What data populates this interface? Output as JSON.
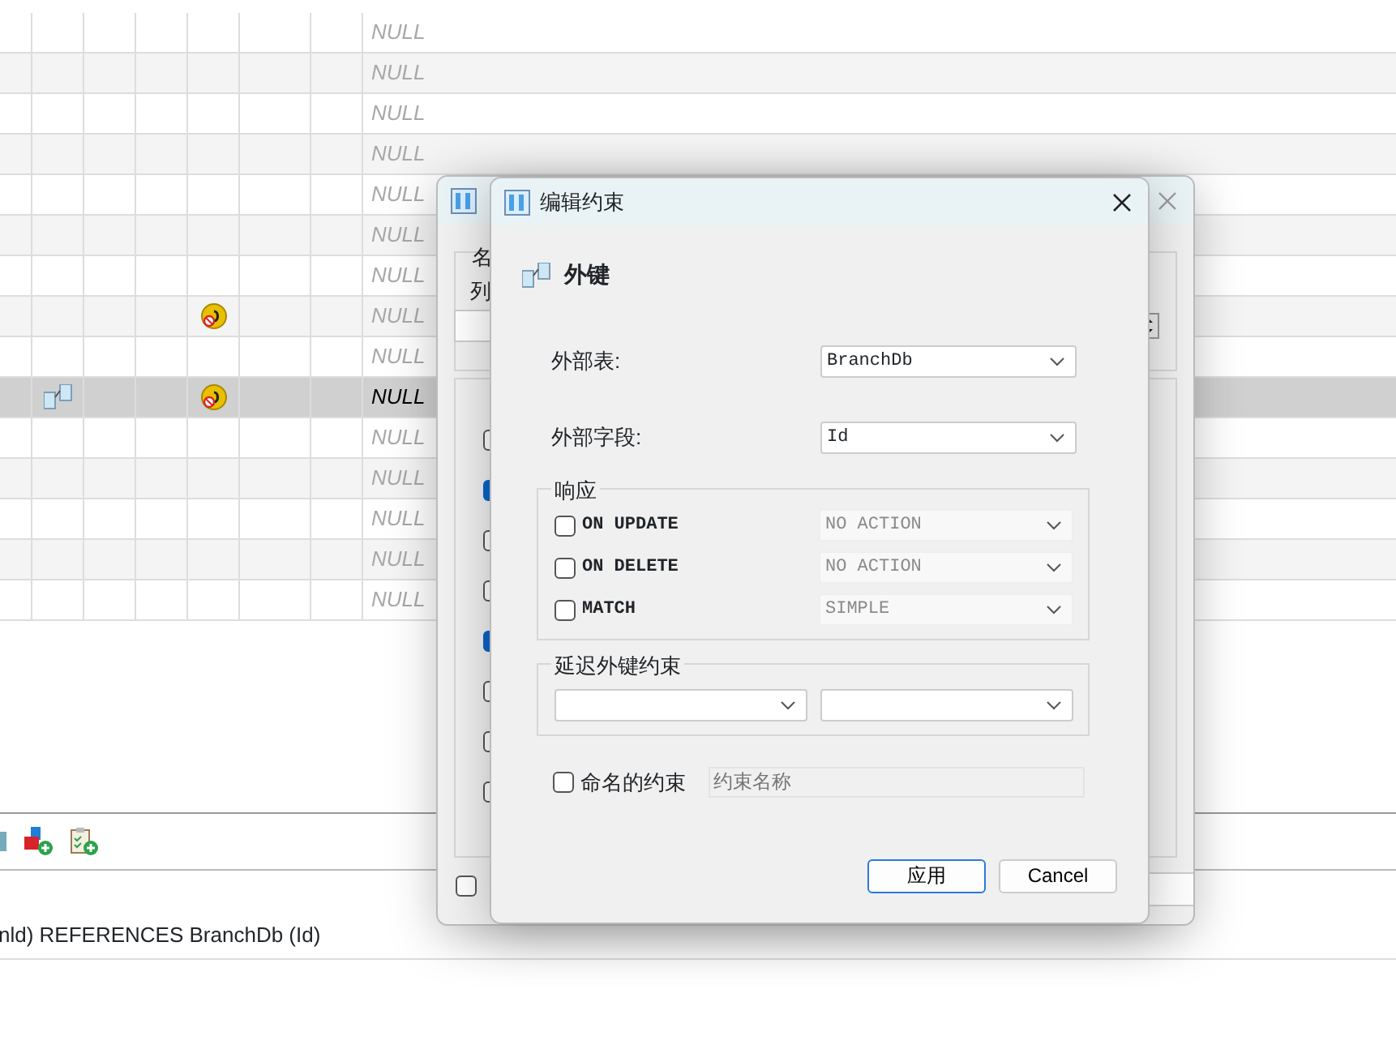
{
  "grid": {
    "rows": [
      {
        "selected": false,
        "foreign_key": false,
        "marked": false,
        "value": "NULL"
      },
      {
        "selected": false,
        "foreign_key": false,
        "marked": false,
        "value": "NULL"
      },
      {
        "selected": false,
        "foreign_key": false,
        "marked": false,
        "value": "NULL"
      },
      {
        "selected": false,
        "foreign_key": false,
        "marked": false,
        "value": "NULL"
      },
      {
        "selected": false,
        "foreign_key": false,
        "marked": false,
        "value": "NULL"
      },
      {
        "selected": false,
        "foreign_key": false,
        "marked": false,
        "value": "NULL"
      },
      {
        "selected": false,
        "foreign_key": false,
        "marked": false,
        "value": "NULL"
      },
      {
        "selected": false,
        "foreign_key": false,
        "marked": true,
        "value": "NULL"
      },
      {
        "selected": false,
        "foreign_key": false,
        "marked": false,
        "value": "NULL"
      },
      {
        "selected": true,
        "foreign_key": true,
        "marked": true,
        "value": "NULL"
      },
      {
        "selected": false,
        "foreign_key": false,
        "marked": false,
        "value": "NULL"
      },
      {
        "selected": false,
        "foreign_key": false,
        "marked": false,
        "value": "NULL"
      },
      {
        "selected": false,
        "foreign_key": false,
        "marked": false,
        "value": "NULL"
      },
      {
        "selected": false,
        "foreign_key": false,
        "marked": false,
        "value": "NULL"
      },
      {
        "selected": false,
        "foreign_key": false,
        "marked": false,
        "value": "NULL"
      }
    ]
  },
  "sql_preview": "nld) REFERENCES BranchDb (Id)",
  "back_dialog": {
    "name_label": "名",
    "column_label": "列",
    "checkboxes": [
      {
        "checked": false
      },
      {
        "checked": true
      },
      {
        "checked": false
      },
      {
        "checked": false
      },
      {
        "checked": true
      },
      {
        "checked": false
      },
      {
        "checked": false
      },
      {
        "checked": false
      }
    ],
    "advanced_checked": false
  },
  "dialog": {
    "title": "编辑约束",
    "heading": "外键",
    "foreign_table": {
      "label": "外部表:",
      "value": "BranchDb"
    },
    "foreign_field": {
      "label": "外部字段:",
      "value": "Id"
    },
    "response": {
      "title": "响应",
      "rows": [
        {
          "label": "ON UPDATE",
          "checked": false,
          "value": "NO ACTION",
          "disabled": true
        },
        {
          "label": "ON DELETE",
          "checked": false,
          "value": "NO ACTION",
          "disabled": true
        },
        {
          "label": "MATCH",
          "checked": false,
          "value": "SIMPLE",
          "disabled": true
        }
      ]
    },
    "deferred": {
      "title": "延迟外键约束"
    },
    "named": {
      "label": "命名的约束",
      "checked": false,
      "placeholder": "约束名称",
      "disabled": true
    },
    "buttons": [
      {
        "label": "应用",
        "primary": true
      },
      {
        "label": "Cancel",
        "primary": false
      }
    ]
  }
}
